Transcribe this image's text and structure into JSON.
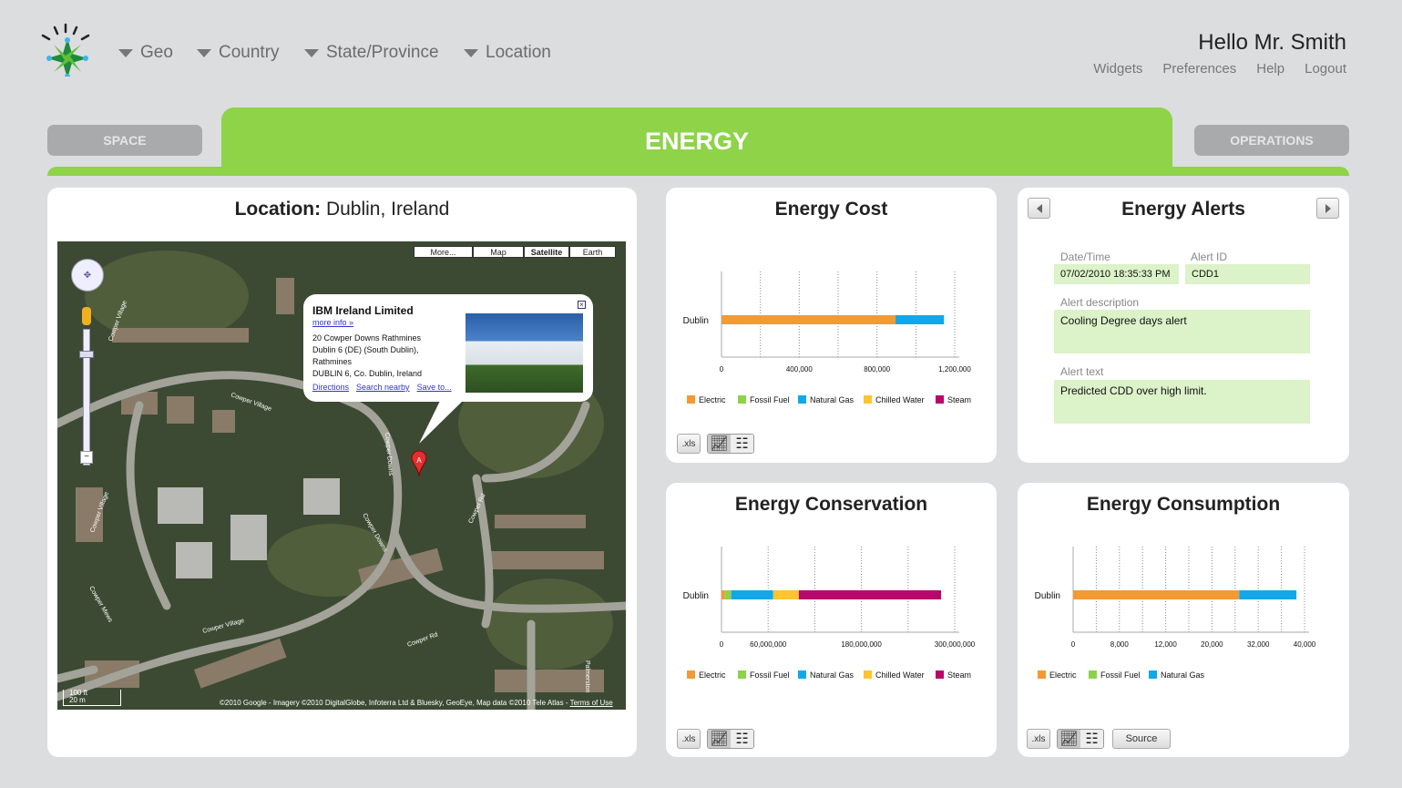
{
  "header": {
    "nav": [
      "Geo",
      "Country",
      "State/Province",
      "Location"
    ],
    "greeting": "Hello Mr. Smith",
    "links": [
      "Widgets",
      "Preferences",
      "Help",
      "Logout"
    ]
  },
  "tabs": {
    "left": "SPACE",
    "active": "ENERGY",
    "right": "OPERATIONS"
  },
  "location_panel": {
    "title_label": "Location:",
    "title_value": "Dublin, Ireland",
    "map": {
      "types": [
        "More...",
        "Map",
        "Satellite",
        "Earth"
      ],
      "selected_type": "Satellite",
      "popup": {
        "title": "IBM Ireland Limited",
        "more_info": "more info »",
        "address": [
          "20 Cowper Downs Rathmines",
          "Dublin 6 (DE) (South Dublin),",
          "Rathmines",
          "DUBLIN 6, Co. Dublin, Ireland"
        ],
        "links": [
          "Directions",
          "Search nearby",
          "Save to..."
        ]
      },
      "marker": "A",
      "scale": [
        "100 ft",
        "20 m"
      ],
      "attribution": "©2010 Google - Imagery ©2010 DigitalGlobe, Infoterra Ltd & Bluesky, GeoEye, Map data ©2010 Tele Atlas -",
      "terms": "Terms of Use",
      "street_labels": [
        "Cowper Village",
        "Cowper Village",
        "Cowper Downs",
        "Cowper Downs",
        "Cowper Rd",
        "Cowper Village",
        "Cowper Rd",
        "Cowper Mews",
        "Cowper Village",
        "Palmerston"
      ]
    }
  },
  "colors": {
    "Electric": "#f39a32",
    "Fossil Fuel": "#8dd24a",
    "Natural Gas": "#10a8ea",
    "Chilled Water": "#fdc42c",
    "Steam": "#b8066a",
    "accent": "#8ed348"
  },
  "toolbar": {
    "xls": ".xls",
    "source": "Source"
  },
  "alerts": {
    "title": "Energy Alerts",
    "datetime_label": "Date/Time",
    "datetime": "07/02/2010  18:35:33 PM",
    "id_label": "Alert ID",
    "id": "CDD1",
    "description_label": "Alert description",
    "description": "Cooling Degree days alert",
    "text_label": "Alert text",
    "text": "Predicted CDD over high limit."
  },
  "chart_data": [
    {
      "id": "cost",
      "title": "Energy Cost",
      "type": "bar",
      "orientation": "horizontal",
      "stacked": true,
      "categories": [
        "Dublin"
      ],
      "xlim": [
        0,
        1200000
      ],
      "grid": true,
      "gridlines": [
        0,
        200000,
        400000,
        600000,
        800000,
        1000000,
        1200000
      ],
      "ticks": [
        {
          "at": 0,
          "label": "0"
        },
        {
          "at": 400000,
          "label": "400,000"
        },
        {
          "at": 800000,
          "label": "800,000"
        },
        {
          "at": 1200000,
          "label": "1,200,000"
        }
      ],
      "series": [
        {
          "name": "Electric",
          "values": [
            895000
          ]
        },
        {
          "name": "Fossil Fuel",
          "values": [
            0
          ]
        },
        {
          "name": "Natural Gas",
          "values": [
            250000
          ]
        },
        {
          "name": "Chilled Water",
          "values": [
            0
          ]
        },
        {
          "name": "Steam",
          "values": [
            0
          ]
        }
      ],
      "legend": "bottom"
    },
    {
      "id": "conservation",
      "title": "Energy Conservation",
      "type": "bar",
      "orientation": "horizontal",
      "stacked": true,
      "categories": [
        "Dublin"
      ],
      "xlim": [
        0,
        300000000
      ],
      "grid": true,
      "gridlines": [
        0,
        60000000,
        120000000,
        180000000,
        240000000,
        300000000
      ],
      "ticks": [
        {
          "at": 0,
          "label": "0"
        },
        {
          "at": 60000000,
          "label": "60,000,000"
        },
        {
          "at": 180000000,
          "label": "180,000,000"
        },
        {
          "at": 300000000,
          "label": "300,000,000"
        }
      ],
      "series": [
        {
          "name": "Electric",
          "values": [
            4500000
          ]
        },
        {
          "name": "Fossil Fuel",
          "values": [
            8000000
          ]
        },
        {
          "name": "Natural Gas",
          "values": [
            54000000
          ]
        },
        {
          "name": "Chilled Water",
          "values": [
            33000000
          ]
        },
        {
          "name": "Steam",
          "values": [
            183000000
          ]
        }
      ],
      "legend": "bottom"
    },
    {
      "id": "consumption",
      "title": "Energy Consumption",
      "type": "bar",
      "orientation": "horizontal",
      "stacked": true,
      "categories": [
        "Dublin"
      ],
      "xlim": [
        0,
        40000
      ],
      "grid": true,
      "gridlines": [
        0,
        4000,
        8000,
        12000,
        16000,
        20000,
        24000,
        28000,
        32000,
        36000,
        40000
      ],
      "ticks": [
        {
          "at": 0,
          "label": "0"
        },
        {
          "at": 8000,
          "label": "8,000"
        },
        {
          "at": 16000,
          "label": "12,000"
        },
        {
          "at": 24000,
          "label": "20,000"
        },
        {
          "at": 32000,
          "label": "32,000"
        },
        {
          "at": 40000,
          "label": "40,000"
        }
      ],
      "series": [
        {
          "name": "Electric",
          "values": [
            28700
          ]
        },
        {
          "name": "Fossil Fuel",
          "values": [
            0
          ]
        },
        {
          "name": "Natural Gas",
          "values": [
            9900
          ]
        }
      ],
      "legend": "bottom"
    }
  ]
}
